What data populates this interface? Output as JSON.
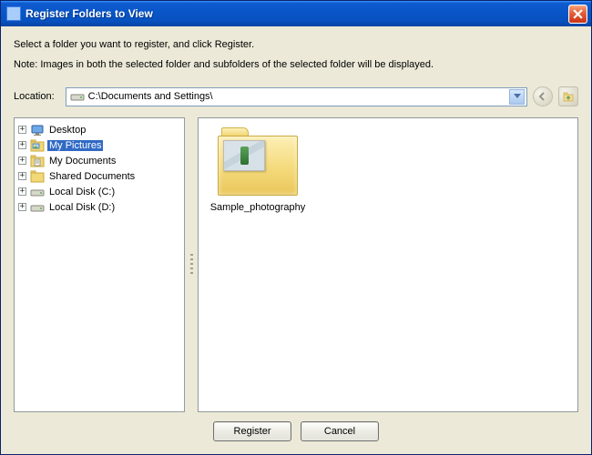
{
  "window": {
    "title": "Register Folders to View"
  },
  "instruction": "Select a folder you want to register, and click Register.",
  "note": "Note: Images in both the selected folder and subfolders of the selected folder will be displayed.",
  "location": {
    "label": "Location:",
    "path": "C:\\Documents and Settings\\"
  },
  "tree": {
    "items": [
      {
        "label": "Desktop",
        "icon": "desktop",
        "expandable": true
      },
      {
        "label": "My Pictures",
        "icon": "pictures",
        "expandable": true,
        "selected": true
      },
      {
        "label": "My Documents",
        "icon": "documents",
        "expandable": true
      },
      {
        "label": "Shared Documents",
        "icon": "folder",
        "expandable": true
      },
      {
        "label": "Local Disk (C:)",
        "icon": "drive",
        "expandable": true
      },
      {
        "label": "Local Disk (D:)",
        "icon": "drive",
        "expandable": true
      }
    ]
  },
  "folders": {
    "items": [
      {
        "label": "Sample_photography"
      }
    ]
  },
  "buttons": {
    "register": "Register",
    "cancel": "Cancel"
  },
  "icons": {
    "back": "back-icon",
    "up": "up-folder-icon"
  }
}
